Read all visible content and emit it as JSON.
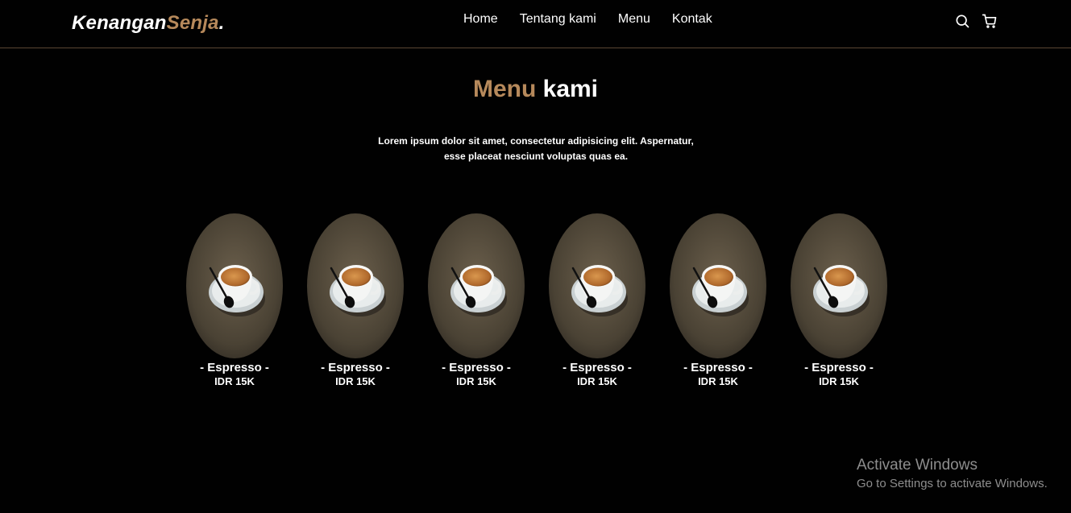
{
  "brand": {
    "main": "Kenangan",
    "accent": "Senja",
    "dot": ".",
    "accent_color": "#b6895b"
  },
  "nav": {
    "links": [
      {
        "label": "Home"
      },
      {
        "label": "Tentang kami"
      },
      {
        "label": "Menu"
      },
      {
        "label": "Kontak"
      }
    ],
    "icons": [
      "search-icon",
      "shopping-cart-icon"
    ]
  },
  "section": {
    "title_accent": "Menu",
    "title_rest": " kami",
    "description_line1": "Lorem ipsum dolor sit amet, consectetur adipisicing elit. Aspernatur,",
    "description_line2": "esse placeat nesciunt voluptas quas ea."
  },
  "menu": {
    "items": [
      {
        "name": "- Espresso -",
        "price": "IDR 15K"
      },
      {
        "name": "- Espresso -",
        "price": "IDR 15K"
      },
      {
        "name": "- Espresso -",
        "price": "IDR 15K"
      },
      {
        "name": "- Espresso -",
        "price": "IDR 15K"
      },
      {
        "name": "- Espresso -",
        "price": "IDR 15K"
      },
      {
        "name": "- Espresso -",
        "price": "IDR 15K"
      }
    ]
  },
  "os_watermark": {
    "line1": "Activate Windows",
    "line2": "Go to Settings to activate Windows."
  },
  "colors": {
    "background": "#010101",
    "accent": "#b6895b",
    "text": "#ffffff"
  }
}
